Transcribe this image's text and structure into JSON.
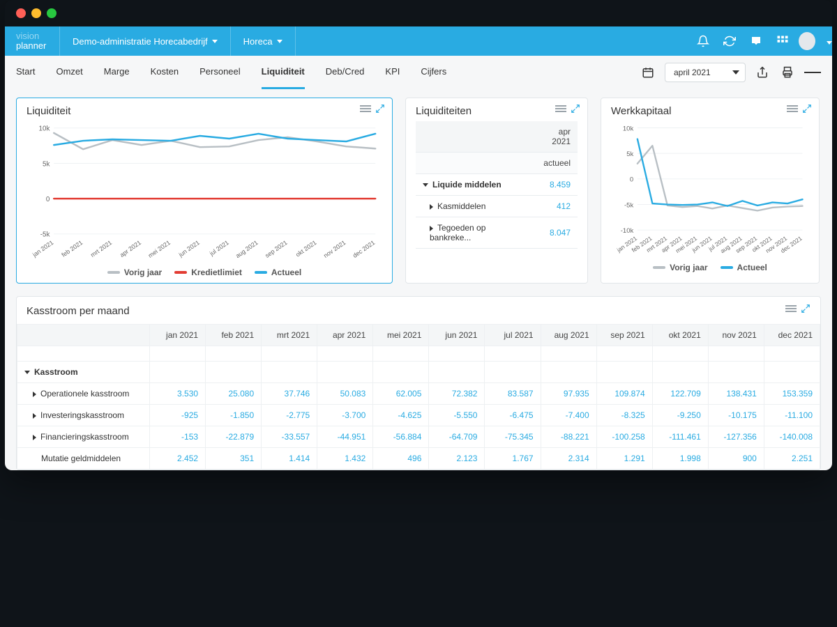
{
  "brand": {
    "line1": "vision",
    "line2": "planner"
  },
  "header": {
    "admin_dropdown": "Demo-administratie Horecabedrijf",
    "sector_dropdown": "Horeca"
  },
  "tabs": [
    "Start",
    "Omzet",
    "Marge",
    "Kosten",
    "Personeel",
    "Liquiditeit",
    "Deb/Cred",
    "KPI",
    "Cijfers"
  ],
  "active_tab": "Liquiditeit",
  "period_selector": "april 2021",
  "cards": {
    "liquiditeit": {
      "title": "Liquiditeit"
    },
    "liquiditeiten": {
      "title": "Liquiditeiten",
      "colhead1": "apr 2021",
      "colhead2": "actueel",
      "rows": [
        {
          "label": "Liquide middelen",
          "value": "8.459",
          "expandable": "open"
        },
        {
          "label": "Kasmiddelen",
          "value": "412",
          "expandable": "closed"
        },
        {
          "label": "Tegoeden op bankreke...",
          "value": "8.047",
          "expandable": "closed"
        }
      ]
    },
    "werkkapitaal": {
      "title": "Werkkapitaal"
    },
    "kasstroom": {
      "title": "Kasstroom per maand"
    }
  },
  "months": [
    "jan 2021",
    "feb 2021",
    "mrt 2021",
    "apr 2021",
    "mei 2021",
    "jun 2021",
    "jul 2021",
    "aug 2021",
    "sep 2021",
    "okt 2021",
    "nov 2021",
    "dec 2021"
  ],
  "kasstroom_rows": [
    {
      "label": "Kasstroom",
      "type": "group"
    },
    {
      "label": "Operationele kasstroom",
      "type": "sub",
      "values": [
        "3.530",
        "25.080",
        "37.746",
        "50.083",
        "62.005",
        "72.382",
        "83.587",
        "97.935",
        "109.874",
        "122.709",
        "138.431",
        "153.359"
      ]
    },
    {
      "label": "Investeringskasstroom",
      "type": "sub",
      "values": [
        "-925",
        "-1.850",
        "-2.775",
        "-3.700",
        "-4.625",
        "-5.550",
        "-6.475",
        "-7.400",
        "-8.325",
        "-9.250",
        "-10.175",
        "-11.100"
      ]
    },
    {
      "label": "Financieringskasstroom",
      "type": "sub",
      "values": [
        "-153",
        "-22.879",
        "-33.557",
        "-44.951",
        "-56.884",
        "-64.709",
        "-75.345",
        "-88.221",
        "-100.258",
        "-111.461",
        "-127.356",
        "-140.008"
      ]
    },
    {
      "label": "Mutatie geldmiddelen",
      "type": "total",
      "values": [
        "2.452",
        "351",
        "1.414",
        "1.432",
        "496",
        "2.123",
        "1.767",
        "2.314",
        "1.291",
        "1.998",
        "900",
        "2.251"
      ]
    }
  ],
  "legend_liquiditeit": [
    "Vorig jaar",
    "Kredietlimiet",
    "Actueel"
  ],
  "legend_werkkapitaal": [
    "Vorig jaar",
    "Actueel"
  ],
  "chart_data": [
    {
      "id": "liquiditeit",
      "type": "line",
      "title": "Liquiditeit",
      "xlabel": "",
      "ylabel": "",
      "ylim": [
        -5000,
        10000
      ],
      "yticks": [
        "-5k",
        "0",
        "5k",
        "10k"
      ],
      "categories": [
        "jan 2021",
        "feb 2021",
        "mrt 2021",
        "apr 2021",
        "mei 2021",
        "jun 2021",
        "jul 2021",
        "aug 2021",
        "sep 2021",
        "okt 2021",
        "nov 2021",
        "dec 2021"
      ],
      "series": [
        {
          "name": "Vorig jaar",
          "color": "#b8bfc4",
          "values": [
            9300,
            7000,
            8300,
            7600,
            8200,
            7300,
            7400,
            8300,
            8700,
            8100,
            7400,
            7100
          ]
        },
        {
          "name": "Kredietlimiet",
          "color": "#e23c33",
          "values": [
            0,
            0,
            0,
            0,
            0,
            0,
            0,
            0,
            0,
            0,
            0,
            0
          ]
        },
        {
          "name": "Actueel",
          "color": "#29abe2",
          "values": [
            7600,
            8200,
            8400,
            8300,
            8200,
            8900,
            8500,
            9200,
            8500,
            8300,
            8100,
            9200
          ]
        }
      ]
    },
    {
      "id": "werkkapitaal",
      "type": "line",
      "title": "Werkkapitaal",
      "xlabel": "",
      "ylabel": "",
      "ylim": [
        -10000,
        10000
      ],
      "yticks": [
        "-10k",
        "-5k",
        "0",
        "5k",
        "10k"
      ],
      "categories": [
        "jan 2021",
        "feb 2021",
        "mrt 2021",
        "apr 2021",
        "mei 2021",
        "jun 2021",
        "jul 2021",
        "aug 2021",
        "sep 2021",
        "okt 2021",
        "nov 2021",
        "dec 2021"
      ],
      "series": [
        {
          "name": "Vorig jaar",
          "color": "#b8bfc4",
          "values": [
            3000,
            6500,
            -5200,
            -5500,
            -5300,
            -5800,
            -5200,
            -5700,
            -6200,
            -5600,
            -5400,
            -5300
          ]
        },
        {
          "name": "Actueel",
          "color": "#29abe2",
          "values": [
            7800,
            -4800,
            -5000,
            -5100,
            -5000,
            -4600,
            -5300,
            -4300,
            -5200,
            -4600,
            -4800,
            -4000
          ]
        }
      ]
    }
  ]
}
